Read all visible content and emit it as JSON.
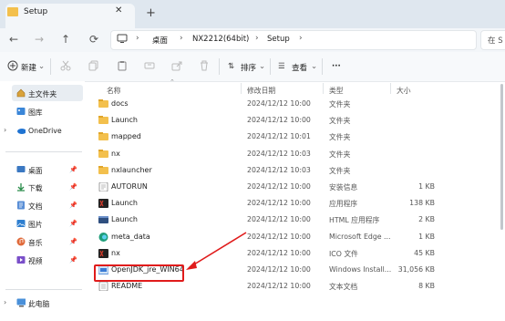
{
  "window": {
    "tab_title": "Setup",
    "tab_close": "✕",
    "new_tab": "+"
  },
  "nav": {
    "back": "←",
    "forward": "→",
    "up": "↑",
    "refresh": "⟳"
  },
  "breadcrumb": [
    "桌面",
    "NX2212(64bit)",
    "Setup"
  ],
  "search": {
    "placeholder": "在 S"
  },
  "toolbar": {
    "new_label": "新建",
    "sort_label": "排序",
    "view_label": "查看",
    "more_label": "···"
  },
  "sidebar": {
    "items": [
      {
        "label": "主文件夹",
        "icon": "home-icon"
      },
      {
        "label": "图库",
        "icon": "gallery-icon"
      },
      {
        "label": "OneDrive",
        "icon": "cloud-icon"
      },
      {
        "label": "桌面",
        "icon": "desktop-icon"
      },
      {
        "label": "下载",
        "icon": "download-icon"
      },
      {
        "label": "文档",
        "icon": "document-icon"
      },
      {
        "label": "图片",
        "icon": "picture-icon"
      },
      {
        "label": "音乐",
        "icon": "music-icon"
      },
      {
        "label": "视频",
        "icon": "video-icon"
      },
      {
        "label": "此电脑",
        "icon": "computer-icon"
      }
    ]
  },
  "columns": {
    "name": "名称",
    "modified": "修改日期",
    "type": "类型",
    "size": "大小"
  },
  "files": [
    {
      "name": "docs",
      "modified": "2024/12/12 10:00",
      "type": "文件夹",
      "size": "",
      "icon": "folder-icon"
    },
    {
      "name": "Launch",
      "modified": "2024/12/12 10:00",
      "type": "文件夹",
      "size": "",
      "icon": "folder-icon"
    },
    {
      "name": "mapped",
      "modified": "2024/12/12 10:01",
      "type": "文件夹",
      "size": "",
      "icon": "folder-icon"
    },
    {
      "name": "nx",
      "modified": "2024/12/12 10:03",
      "type": "文件夹",
      "size": "",
      "icon": "folder-icon"
    },
    {
      "name": "nxlauncher",
      "modified": "2024/12/12 10:03",
      "type": "文件夹",
      "size": "",
      "icon": "folder-icon"
    },
    {
      "name": "AUTORUN",
      "modified": "2024/12/12 10:00",
      "type": "安装信息",
      "size": "1 KB",
      "icon": "setup-info-icon"
    },
    {
      "name": "Launch",
      "modified": "2024/12/12 10:00",
      "type": "应用程序",
      "size": "138 KB",
      "icon": "nx-app-icon"
    },
    {
      "name": "Launch",
      "modified": "2024/12/12 10:00",
      "type": "HTML 应用程序",
      "size": "2 KB",
      "icon": "html-app-icon"
    },
    {
      "name": "meta_data",
      "modified": "2024/12/12 10:00",
      "type": "Microsoft Edge ...",
      "size": "1 KB",
      "icon": "edge-icon"
    },
    {
      "name": "nx",
      "modified": "2024/12/12 10:00",
      "type": "ICO 文件",
      "size": "45 KB",
      "icon": "nx-ico-icon"
    },
    {
      "name": "OpenJDK_jre_WIN64",
      "modified": "2024/12/12 10:00",
      "type": "Windows Install...",
      "size": "31,056 KB",
      "icon": "installer-icon"
    },
    {
      "name": "README",
      "modified": "2024/12/12 10:00",
      "type": "文本文档",
      "size": "8 KB",
      "icon": "text-file-icon"
    }
  ],
  "colors": {
    "annotation": "#e01b1b",
    "folder": "#f3c04d",
    "selection": "#e8edf2"
  }
}
